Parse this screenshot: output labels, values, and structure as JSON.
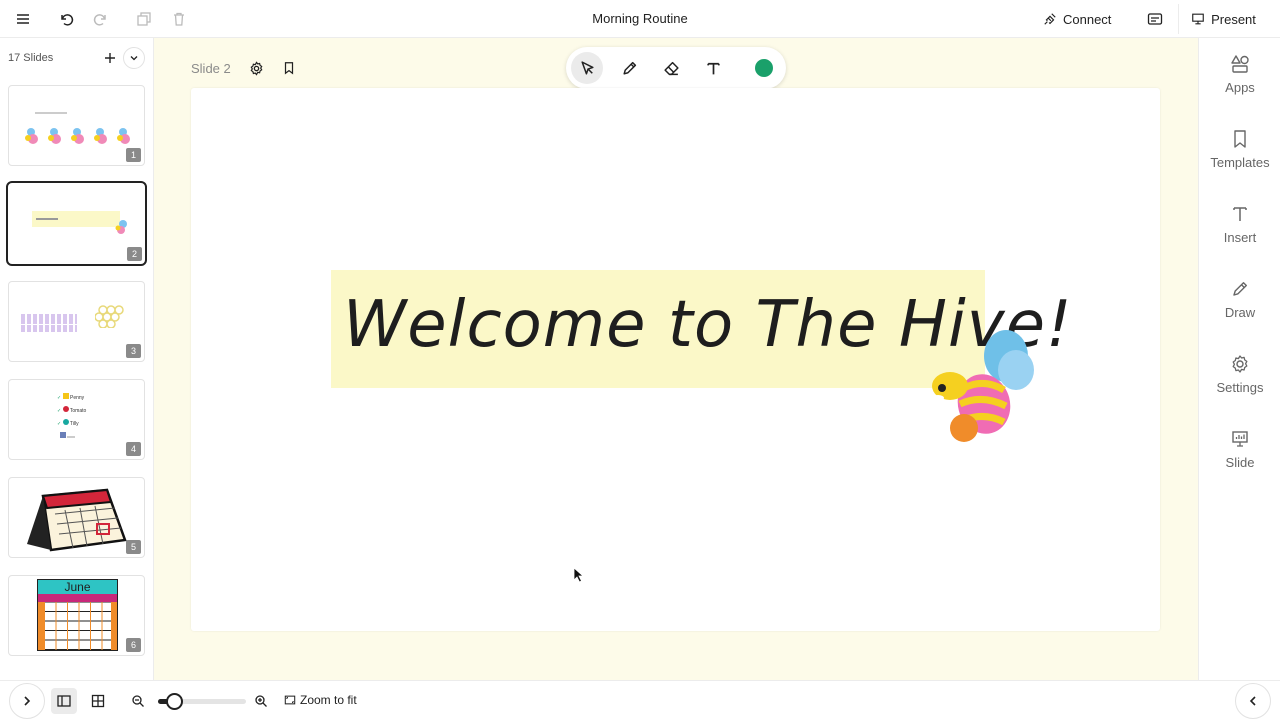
{
  "document": {
    "title": "Morning Routine"
  },
  "topbar": {
    "connect_label": "Connect",
    "present_label": "Present"
  },
  "left_panel": {
    "slide_count_label": "17 Slides",
    "thumbnails": [
      {
        "number": "1",
        "active": false
      },
      {
        "number": "2",
        "active": true
      },
      {
        "number": "3",
        "active": false
      },
      {
        "number": "4",
        "active": false
      },
      {
        "number": "5",
        "active": false
      },
      {
        "number": "6",
        "active": false
      }
    ],
    "thumb4_names": [
      "Penny",
      "Tomato",
      "Tilly"
    ],
    "thumb6_month": "June"
  },
  "canvas": {
    "slide_label": "Slide 2",
    "welcome_text": "Welcome to The Hive!",
    "pen_color": "#1aa06a",
    "highlight_color": "#fbf8c8"
  },
  "right_panel": {
    "items": [
      {
        "label": "Apps",
        "icon": "shapes-icon"
      },
      {
        "label": "Templates",
        "icon": "bookmark-icon"
      },
      {
        "label": "Insert",
        "icon": "text-icon"
      },
      {
        "label": "Draw",
        "icon": "pencil-icon"
      },
      {
        "label": "Settings",
        "icon": "gear-icon"
      },
      {
        "label": "Slide",
        "icon": "presentation-icon"
      }
    ]
  },
  "bottombar": {
    "zoom_fit_label": "Zoom to fit",
    "zoom_level_fraction": 0.18
  }
}
